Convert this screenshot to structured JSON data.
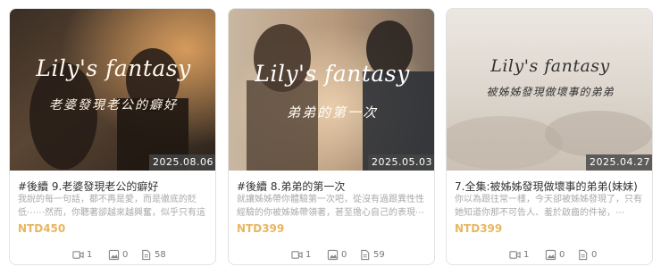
{
  "cards": [
    {
      "brand": "Lily's fantasy",
      "subtitle": "老婆發現老公的癖好",
      "date": "2025.08.06",
      "title": "#後續 9.老婆發現老公的癖好",
      "description": "我說的每一句話，都不再是愛，而是徹底的貶低⋯⋯然而，你聽著卻越來越興奮，似乎只有這",
      "price": "NTD450",
      "stats": {
        "videos": "1",
        "images": "0",
        "docs": "58"
      }
    },
    {
      "brand": "Lily's fantasy",
      "subtitle": "弟弟的第一次",
      "date": "2025.05.03",
      "title": "#後續 8.弟弟的第一次",
      "description": "就讓姊姊帶你體驗第一次吧，從沒有過跟異性性經驗的你被姊姊帶領著，甚至擔心自己的表現⋯",
      "price": "NTD399",
      "stats": {
        "videos": "1",
        "images": "0",
        "docs": "59"
      }
    },
    {
      "brand": "Lily's fantasy",
      "subtitle": "被姊姊發現做壞事的弟弟",
      "date": "2025.04.27",
      "title": "7.全集:被姊姊發現做壞事的弟弟(妹妹)",
      "description": "你以為跟往常一樣，今天卻被姊姊發現了，只有她知道你那不可告人、羞於啟齒的件祕，⋯",
      "price": "NTD399",
      "stats": {
        "videos": "1",
        "images": "0",
        "docs": "0"
      }
    }
  ],
  "icons": {
    "video": "video-icon",
    "image": "image-icon",
    "doc": "document-icon"
  },
  "colors": {
    "price": "#e8b65f",
    "date_badge": "#464646",
    "muted": "#aaaaaa"
  }
}
